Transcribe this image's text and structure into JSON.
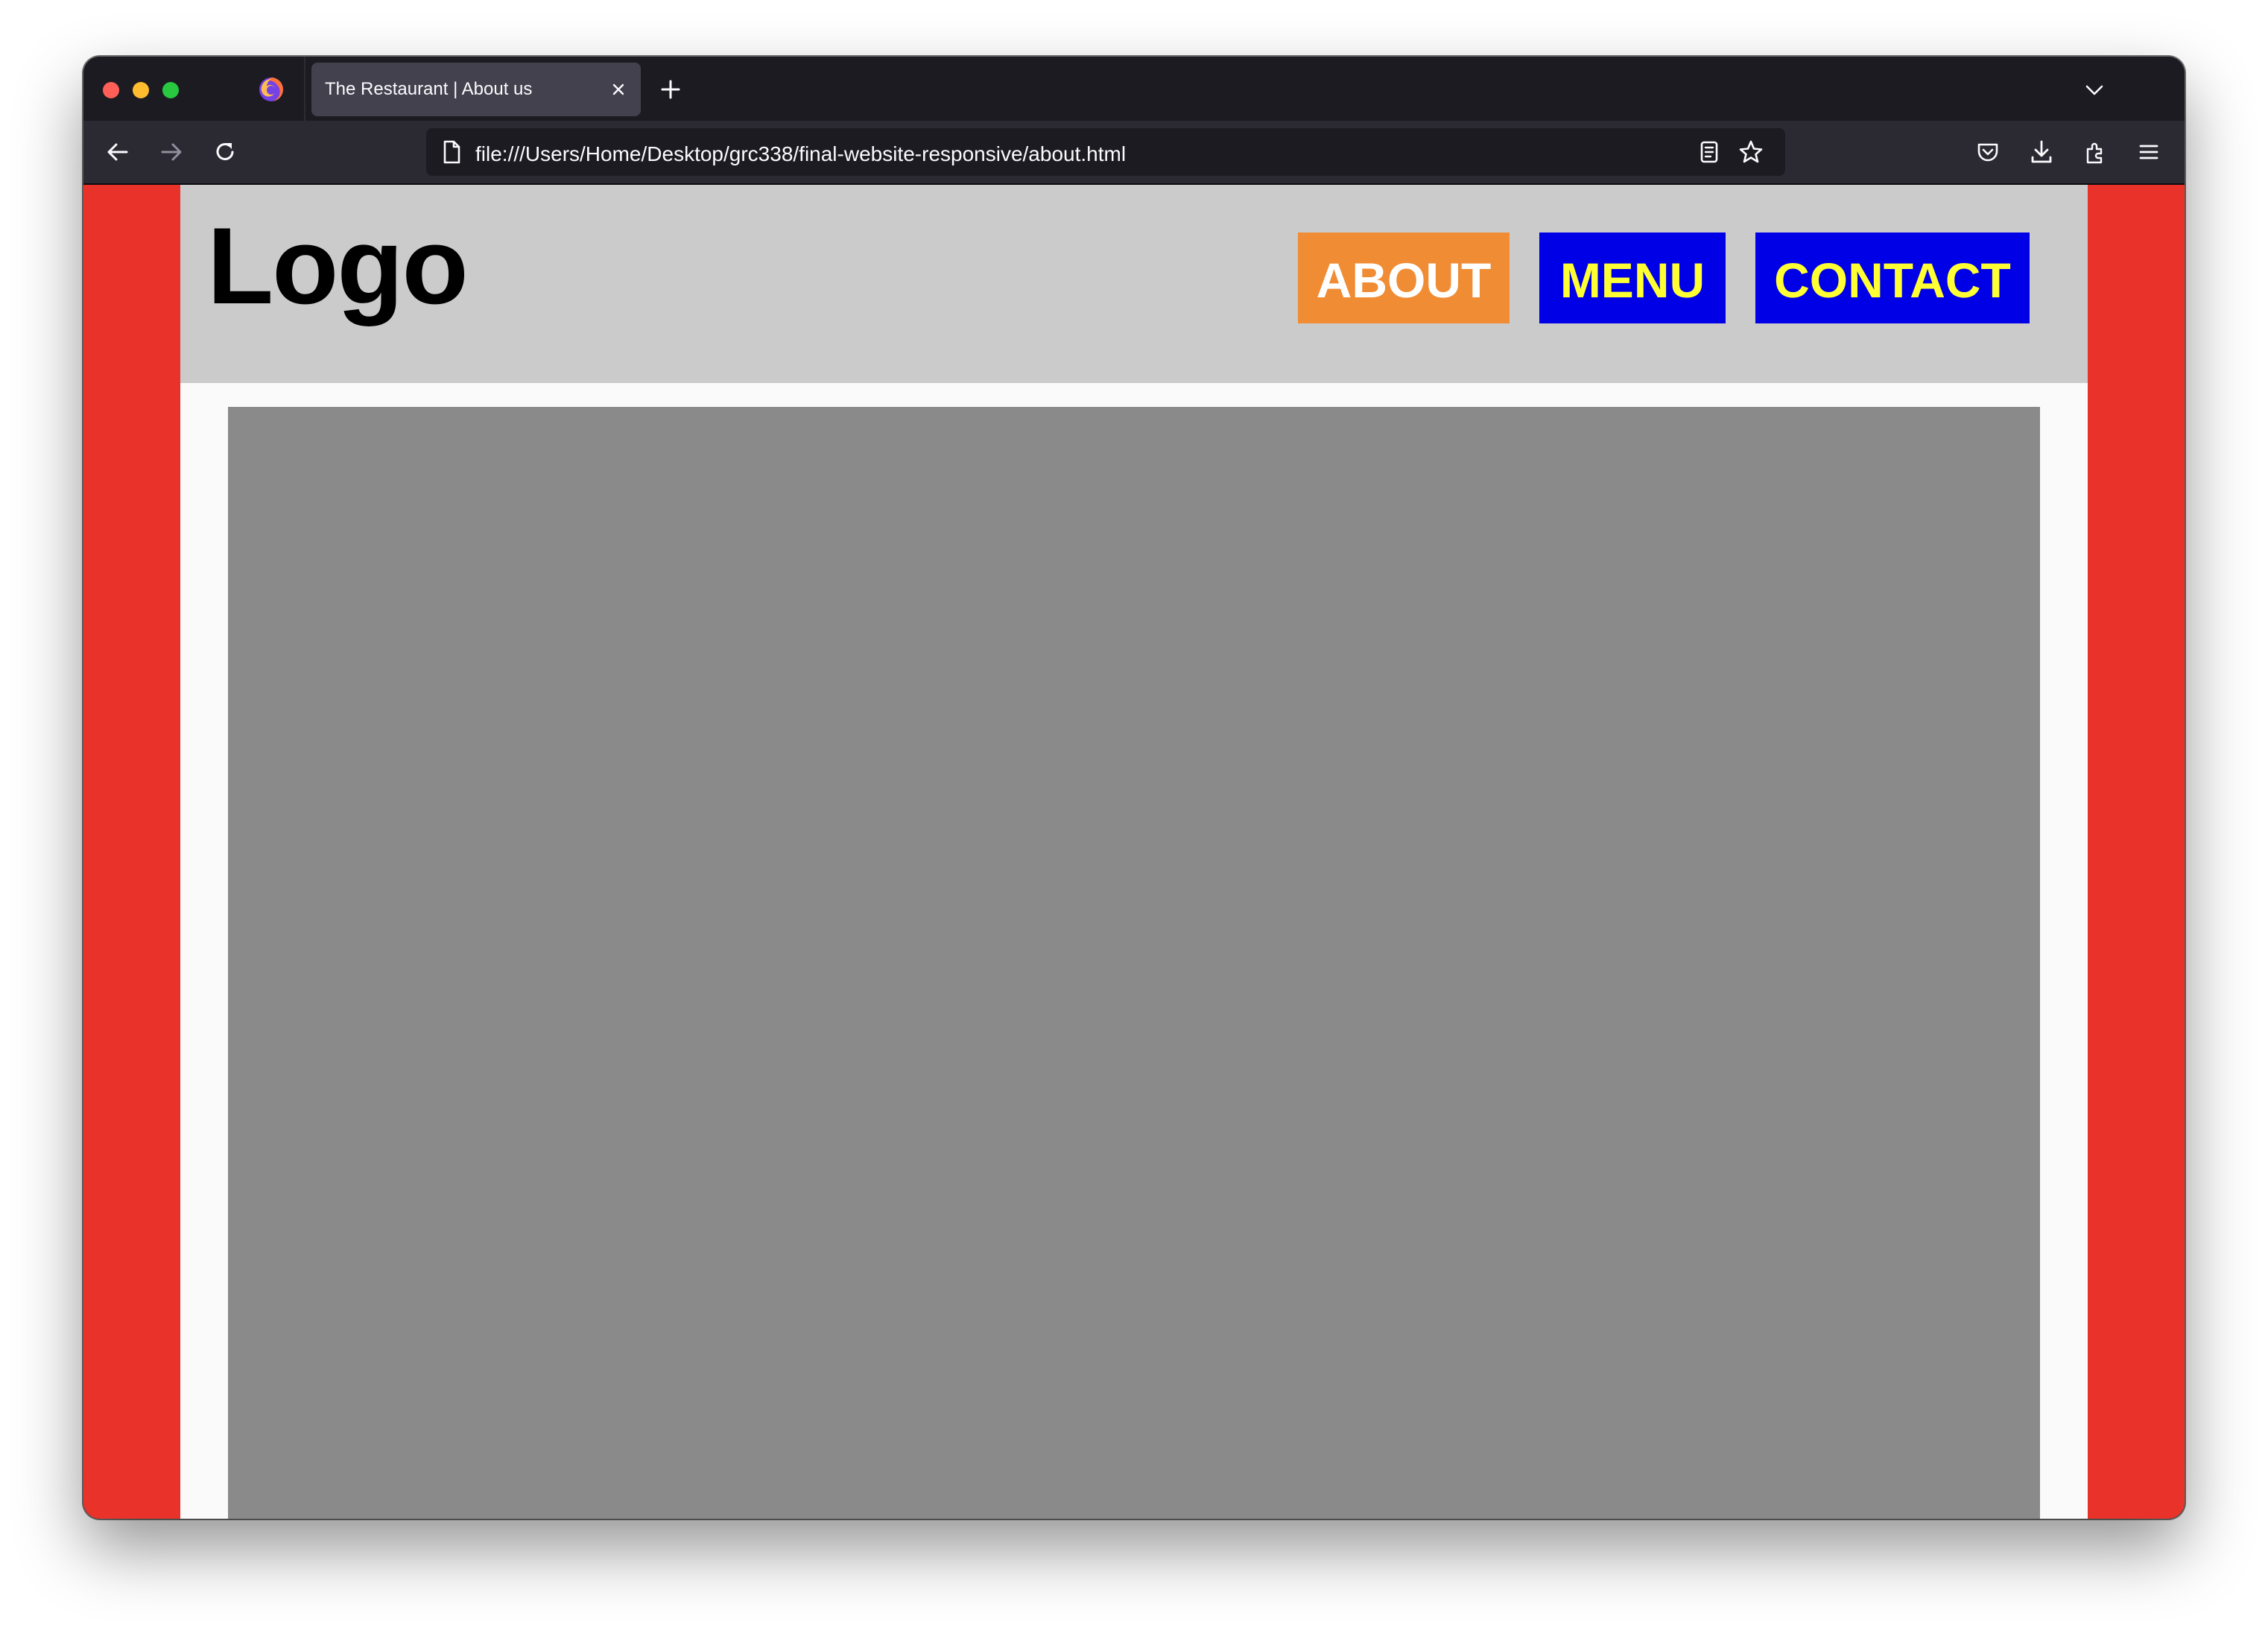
{
  "browser": {
    "tab": {
      "title": "The Restaurant | About us"
    },
    "url": "file:///Users/Home/Desktop/grc338/final-website-responsive/about.html",
    "icons": [
      "firefox-icon",
      "close-icon",
      "plus-icon",
      "chevron-down-icon",
      "back-arrow-icon",
      "forward-arrow-icon",
      "reload-icon",
      "page-icon",
      "reader-view-icon",
      "bookmark-star-icon",
      "pocket-icon",
      "download-icon",
      "extensions-icon",
      "hamburger-menu-icon"
    ]
  },
  "site": {
    "logo": "Logo",
    "nav": {
      "about": "ABOUT",
      "menu": "MENU",
      "contact": "CONTACT"
    },
    "colors": {
      "side_background": "#e8322a",
      "header_background": "#cbcbcb",
      "about_button": "#f08c34",
      "menu_button": "#0000e6",
      "button_text_active": "#ffffff",
      "button_text": "#ffff33",
      "image_placeholder": "#8a8a8a"
    }
  }
}
